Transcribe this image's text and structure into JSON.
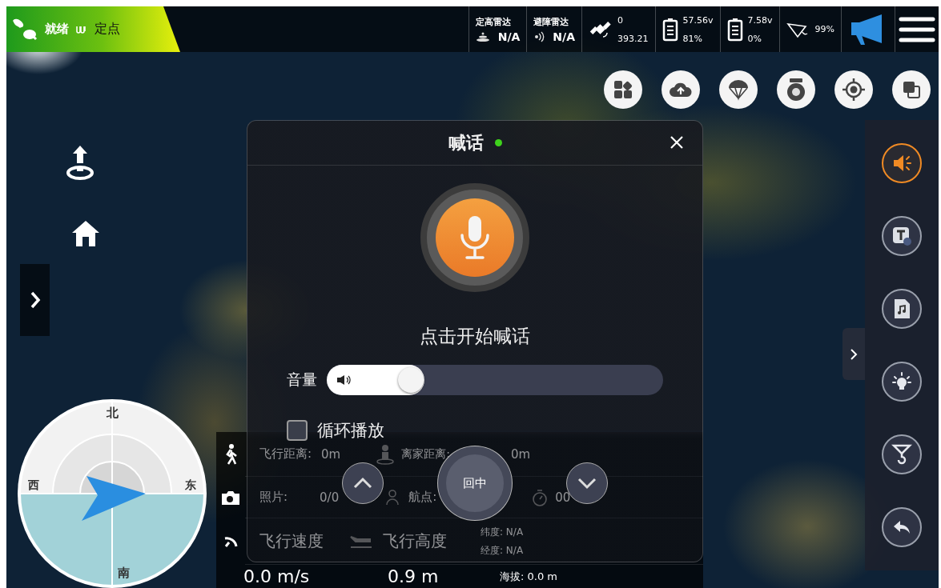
{
  "status_badge": {
    "state": "就绪",
    "mode": "定点"
  },
  "top_bar": {
    "radars": [
      {
        "label": "定高雷达",
        "value": "N/A",
        "kind": "altitude"
      },
      {
        "label": "避障雷达",
        "value": "N/A",
        "kind": "obstacle"
      }
    ],
    "satellite": {
      "count": "0",
      "value": "393.21"
    },
    "batteries": [
      {
        "voltage": "57.56v",
        "percent": "81%"
      },
      {
        "voltage": "7.58v",
        "percent": "0%"
      }
    ],
    "remote_signal": "99%"
  },
  "right_toolbar": [
    {
      "kind": "speaker",
      "selected": true
    },
    {
      "kind": "text-speech",
      "selected": false
    },
    {
      "kind": "audio-file",
      "selected": false
    },
    {
      "kind": "light",
      "selected": false
    },
    {
      "kind": "hook",
      "selected": false
    },
    {
      "kind": "back",
      "selected": false
    }
  ],
  "dialog": {
    "title": "喊话",
    "online": true,
    "prompt": "点击开始喊话",
    "volume": {
      "label": "音量",
      "level": 0.29
    },
    "loop": {
      "label": "循环播放",
      "checked": false
    },
    "center_button": "回中"
  },
  "telemetry": {
    "flight_distance": "飞行距离:",
    "flight_distance_value": "0m",
    "home_distance": "离家距离:",
    "home_distance_value": "0m",
    "photos": "照片:",
    "photos_value": "0/0",
    "waypoints": "航点:",
    "timer_value": "00",
    "speed_label": "飞行速度",
    "altitude_label": "飞行高度",
    "latitude": "纬度: N/A",
    "longitude": "经度: N/A",
    "speed": "0.0 m/s",
    "altitude": "0.9 m",
    "elevation": "海拔: 0.0 m"
  },
  "compass": {
    "north": "北",
    "west": "西",
    "east": "东",
    "south": "南"
  }
}
